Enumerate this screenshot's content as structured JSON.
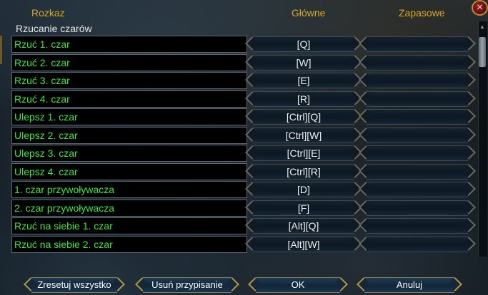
{
  "header": {
    "command_col": "Rozkaz",
    "main_col": "Główne",
    "alt_col": "Zapasowe"
  },
  "close_icon": "×",
  "section_title": "Rzucanie czarów",
  "rows": [
    {
      "command": "Rzuć 1. czar",
      "main": "[Q]",
      "alt": ""
    },
    {
      "command": "Rzuć 2. czar",
      "main": "[W]",
      "alt": ""
    },
    {
      "command": "Rzuć 3. czar",
      "main": "[E]",
      "alt": ""
    },
    {
      "command": "Rzuć 4. czar",
      "main": "[R]",
      "alt": ""
    },
    {
      "command": "Ulepsz 1. czar",
      "main": "[Ctrl][Q]",
      "alt": ""
    },
    {
      "command": "Ulepsz 2. czar",
      "main": "[Ctrl][W]",
      "alt": ""
    },
    {
      "command": "Ulepsz 3. czar",
      "main": "[Ctrl][E]",
      "alt": ""
    },
    {
      "command": "Ulepsz 4. czar",
      "main": "[Ctrl][R]",
      "alt": ""
    },
    {
      "command": "1. czar przywoływacza",
      "main": "[D]",
      "alt": ""
    },
    {
      "command": "2. czar przywoływacza",
      "main": "[F]",
      "alt": ""
    },
    {
      "command": "Rzuć na siebie 1. czar",
      "main": "[Alt][Q]",
      "alt": ""
    },
    {
      "command": "Rzuć na siebie 2. czar",
      "main": "[Alt][W]",
      "alt": ""
    }
  ],
  "buttons": {
    "reset_all": "Zresetuj wszystko",
    "remove_binding": "Usuń przypisanie",
    "ok": "OK",
    "cancel": "Anuluj"
  },
  "colors": {
    "header_gold": "#d8a827",
    "command_green": "#3fe63f",
    "key_text": "#f0f0f0"
  }
}
